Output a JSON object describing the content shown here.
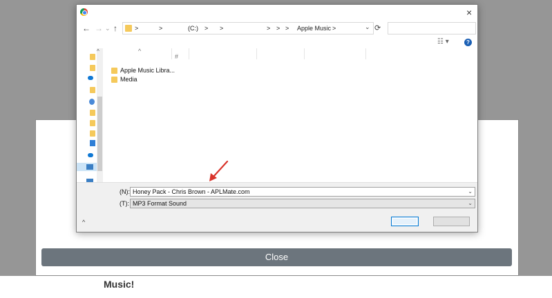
{
  "background": {
    "close_label": "Close",
    "text": "Music!"
  },
  "dialog": {
    "address": {
      "drive": "(C:)",
      "folder": "Apple Music",
      "sep": ">"
    },
    "columns": {
      "hash": "#"
    },
    "files": [
      {
        "name": "Apple Music Libra..."
      },
      {
        "name": "Media"
      }
    ],
    "file_name_label": "(N):",
    "file_name_value": "Honey Pack - Chris Brown - APLMate.com",
    "file_type_label": "(T):",
    "file_type_value": "MP3 Format Sound",
    "help_glyph": "?",
    "close_glyph": "×"
  },
  "colors": {
    "close_button": "#6c757d",
    "annotation_arrow": "#d9342b",
    "folder": "#f5c95b"
  }
}
